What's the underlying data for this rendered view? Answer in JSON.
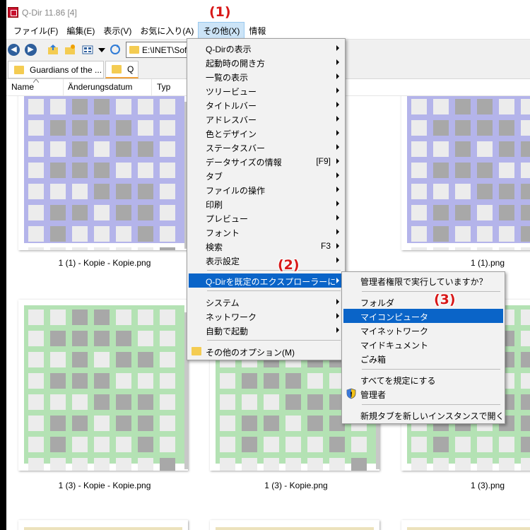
{
  "window": {
    "title": "Q-Dir 11.86 [4]"
  },
  "menubar": {
    "items": [
      {
        "label": "ファイル(F)"
      },
      {
        "label": "編集(E)"
      },
      {
        "label": "表示(V)"
      },
      {
        "label": "お気に入り(A)"
      },
      {
        "label": "その他(X)"
      },
      {
        "label": "情報"
      }
    ]
  },
  "toolbar": {
    "address": "E:\\INET\\Soft"
  },
  "tabs": [
    {
      "label": "Guardians of the ..."
    },
    {
      "label": "Q"
    }
  ],
  "columns": [
    {
      "label": "Name"
    },
    {
      "label": "Änderungsdatum"
    },
    {
      "label": "Typ"
    }
  ],
  "files": [
    {
      "name": "1 (1) - Kopie - Kopie.png",
      "color": "#b4b4ea"
    },
    {
      "name": "1 (1).png",
      "color": "#b4b4ea"
    },
    {
      "name": "1 (3) - Kopie - Kopie.png",
      "color": "#b4e2b4"
    },
    {
      "name": "1 (3) - Kopie.png",
      "color": "#b4e2b4"
    },
    {
      "name": "1 (3).png",
      "color": "#b4e2b4"
    }
  ],
  "menu_other": {
    "items": [
      {
        "label": "Q-Dirの表示"
      },
      {
        "label": "起動時の開き方"
      },
      {
        "label": "一覧の表示"
      },
      {
        "label": "ツリービュー"
      },
      {
        "label": "タイトルバー"
      },
      {
        "label": "アドレスバー"
      },
      {
        "label": "色とデザイン"
      },
      {
        "label": "ステータスバー"
      },
      {
        "label": "データサイズの情報",
        "shortcut": "[F9]"
      },
      {
        "label": "タブ"
      },
      {
        "label": "ファイルの操作"
      },
      {
        "label": "印刷"
      },
      {
        "label": "プレビュー"
      },
      {
        "label": "フォント"
      },
      {
        "label": "検索",
        "shortcut": "F3"
      },
      {
        "label": "表示設定"
      },
      {
        "label": "Q-Dirを既定のエクスプローラーに"
      },
      {
        "label": "システム"
      },
      {
        "label": "ネットワーク"
      },
      {
        "label": "自動で起動"
      },
      {
        "label": "その他のオプション(M)"
      }
    ]
  },
  "submenu_default_explorer": {
    "items": [
      {
        "label": "管理者権限で実行していますか？"
      },
      {
        "label": "フォルダ"
      },
      {
        "label": "マイコンピュータ"
      },
      {
        "label": "マイネットワーク"
      },
      {
        "label": "マイドキュメント"
      },
      {
        "label": "ごみ箱"
      },
      {
        "label": "すべてを規定にする"
      },
      {
        "label": "管理者"
      },
      {
        "label": "新規タブを新しいインスタンスで開く"
      }
    ]
  },
  "annotations": {
    "step1": "(1)",
    "step2": "(2)",
    "step3": "(3)"
  },
  "colors": {
    "highlight": "#0a64c8",
    "annotation": "#d81818"
  }
}
